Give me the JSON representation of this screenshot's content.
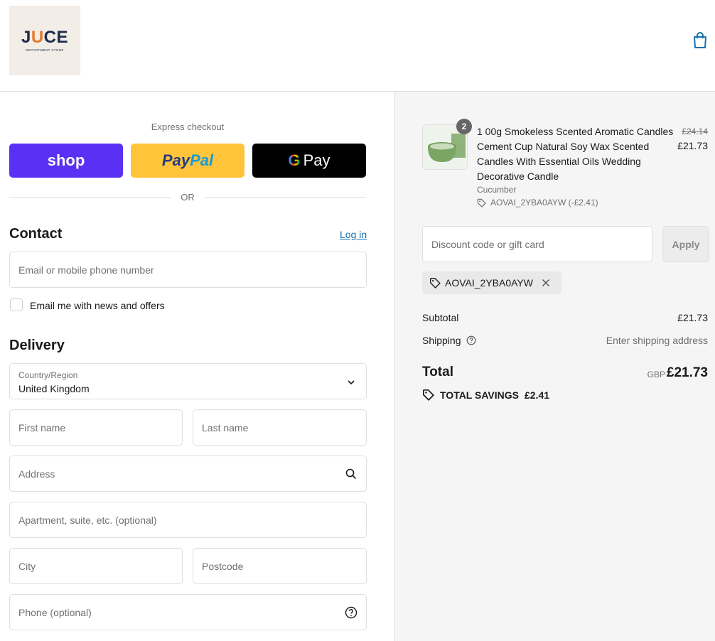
{
  "brand": {
    "logo_word_a": "J",
    "logo_word_u": "U",
    "logo_word_b": "CE",
    "logo_sub": "DEPARTMENT STORE"
  },
  "express": {
    "label": "Express checkout",
    "shop_label": "shop",
    "paypal_a": "Pay",
    "paypal_b": "Pal",
    "gpay_g": "G",
    "gpay_label": "Pay",
    "or_label": "OR"
  },
  "contact": {
    "title": "Contact",
    "login_label": "Log in",
    "email_placeholder": "Email or mobile phone number",
    "newsletter_label": "Email me with news and offers"
  },
  "delivery": {
    "title": "Delivery",
    "country_label": "Country/Region",
    "country_value": "United Kingdom",
    "first_name": "First name",
    "last_name": "Last name",
    "address": "Address",
    "apartment": "Apartment, suite, etc. (optional)",
    "city": "City",
    "postcode": "Postcode",
    "phone": "Phone (optional)"
  },
  "order": {
    "quantity": "2",
    "product_title": "1 00g Smokeless Scented Aromatic Candles Cement Cup Natural Soy Wax Scented Candles With Essential Oils Wedding Decorative Candle",
    "variant": "Cucumber",
    "discount_applied": "AOVAI_2YBA0AYW (-£2.41)",
    "price_old": "£24.14",
    "price_new": "£21.73",
    "discount_placeholder": "Discount code or gift card",
    "apply_label": "Apply",
    "chip_code": "AOVAI_2YBA0AYW",
    "subtotal_label": "Subtotal",
    "subtotal_value": "£21.73",
    "shipping_label": "Shipping",
    "shipping_value": "Enter shipping address",
    "total_label": "Total",
    "total_currency": "GBP",
    "total_value": "£21.73",
    "savings_label": "TOTAL SAVINGS",
    "savings_value": "£2.41"
  },
  "colors": {
    "shop": "#5a31f4",
    "paypal": "#ffc439",
    "gpay": "#000000",
    "link": "#1773b0"
  }
}
